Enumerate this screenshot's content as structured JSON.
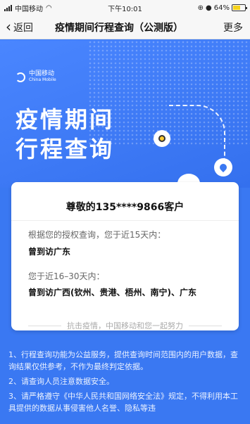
{
  "status_bar": {
    "carrier": "中国移动",
    "time": "下午10:01",
    "battery_percent": "64%",
    "battery_level": 0.64
  },
  "nav": {
    "back_label": "返回",
    "title": "疫情期间行程查询（公测版）",
    "more_label": "更多"
  },
  "banner": {
    "logo_cn": "中国移动",
    "logo_en": "China Mobile",
    "title_line1": "疫情期间",
    "title_line2": "行程查询"
  },
  "result_card": {
    "greeting": "尊敬的135****9866客户",
    "query_15_label": "根据您的授权查询，您于近15天内：",
    "query_15_result": "曾到访广东",
    "query_16_30_label": "您于近16–30天内：",
    "query_16_30_result": "曾到访广西(钦州、贵港、梧州、南宁)、广东",
    "slogan": "抗击疫情，中国移动和您一起努力"
  },
  "notes": [
    "1、行程查询功能为公益服务，提供查询时间范围内的用户数据，查询结果仅供参考，不作为最终判定依据。",
    "2、请查询人员注意数据安全。",
    "3、请严格遵守《中华人民共和国网络安全法》规定，不得利用本工具提供的数据从事侵害他人名誉、隐私等违"
  ],
  "colors": {
    "banner_blue": "#3a78f2",
    "accent_red": "#e23b3b",
    "battery_yellow": "#f5d21a"
  }
}
